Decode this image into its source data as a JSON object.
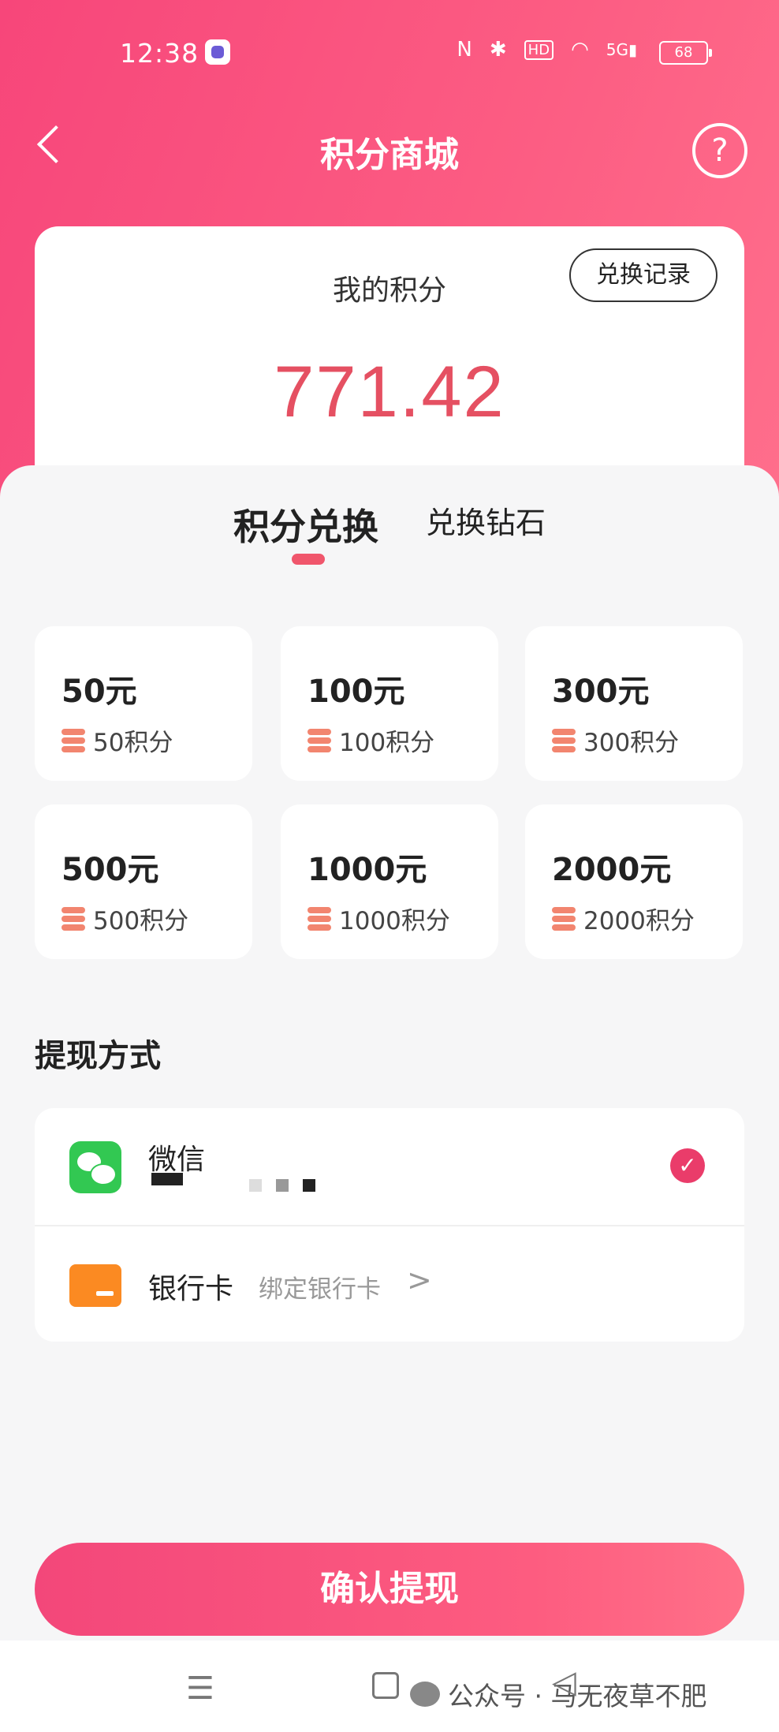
{
  "status_bar": {
    "time": "12:38",
    "icons": [
      "N",
      "✱",
      "HD",
      "wifi",
      "5G"
    ],
    "battery": "68"
  },
  "header": {
    "title": "积分商城",
    "help_label": "?"
  },
  "points": {
    "label": "我的积分",
    "history_label": "兑换记录",
    "value": "771.42"
  },
  "tabs": [
    {
      "label": "积分兑换"
    },
    {
      "label": "兑换钻石"
    }
  ],
  "options": [
    {
      "amount": "50元",
      "cost": "50积分"
    },
    {
      "amount": "100元",
      "cost": "100积分"
    },
    {
      "amount": "300元",
      "cost": "300积分"
    },
    {
      "amount": "500元",
      "cost": "500积分"
    },
    {
      "amount": "1000元",
      "cost": "1000积分"
    },
    {
      "amount": "2000元",
      "cost": "2000积分"
    }
  ],
  "withdraw": {
    "title": "提现方式",
    "wechat_label": "微信",
    "bank_label": "银行卡",
    "bank_hint": "绑定银行卡",
    "bank_chevron": ">"
  },
  "confirm_label": "确认提现",
  "watermark": "公众号 · 马无夜草不肥",
  "colors": {
    "accent": "#f7467a",
    "points": "#e55062",
    "check": "#ea3c6a"
  }
}
